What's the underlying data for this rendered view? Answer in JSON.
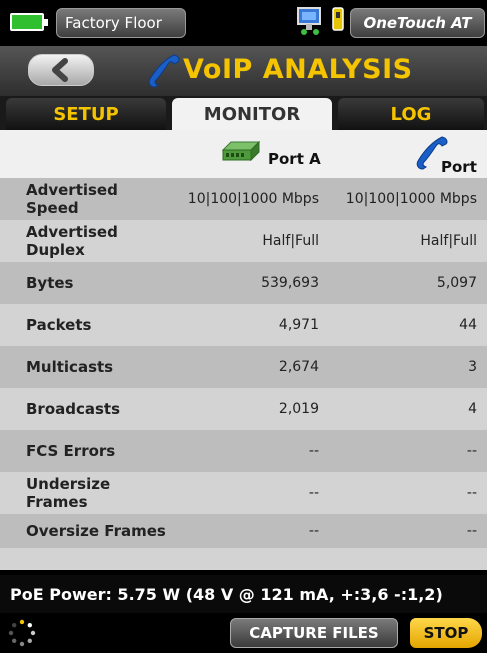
{
  "status_bar": {
    "profile_label": "Factory Floor",
    "product_label": "OneTouch AT",
    "battery_color": "#2fbf2f"
  },
  "header": {
    "title": "VoIP ANALYSIS",
    "title_color": "#f5c400",
    "title_icon": "phone-icon",
    "back_icon": "chevron-left-icon"
  },
  "tabs": [
    {
      "label": "SETUP",
      "active": false
    },
    {
      "label": "MONITOR",
      "active": true
    },
    {
      "label": "LOG",
      "active": false
    }
  ],
  "ports": {
    "a": {
      "label": "Port A",
      "icon": "switch-icon"
    },
    "b": {
      "label": "Port B",
      "icon": "phone-icon"
    }
  },
  "rows": [
    {
      "label": "Advertised Speed",
      "a": "10|100|1000 Mbps",
      "b": "10|100|1000 Mbps"
    },
    {
      "label": "Advertised Duplex",
      "a": "Half|Full",
      "b": "Half|Full"
    },
    {
      "label": "Bytes",
      "a": "539,693",
      "b": "5,097"
    },
    {
      "label": "Packets",
      "a": "4,971",
      "b": "44"
    },
    {
      "label": "Multicasts",
      "a": "2,674",
      "b": "3"
    },
    {
      "label": "Broadcasts",
      "a": "2,019",
      "b": "4"
    },
    {
      "label": "FCS Errors",
      "a": "--",
      "b": "--"
    },
    {
      "label": "Undersize Frames",
      "a": "--",
      "b": "--"
    },
    {
      "label": "Oversize Frames",
      "a": "--",
      "b": "--"
    }
  ],
  "footer": {
    "poe_text": "PoE Power: 5.75 W (48 V @ 121 mA, +:3,6 -:1,2)",
    "capture_label": "CAPTURE FILES",
    "stop_label": "STOP",
    "stop_color": "#f5c400"
  }
}
